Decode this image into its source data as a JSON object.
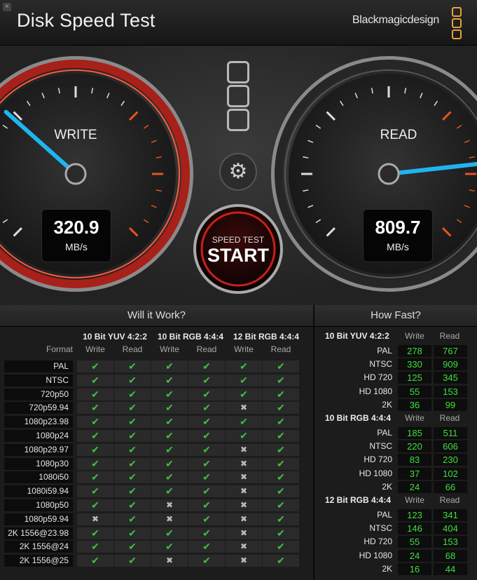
{
  "window": {
    "close_glyph": "×",
    "title": "Disk Speed Test",
    "brand": "Blackmagicdesign"
  },
  "colors": {
    "accent": "#e8a23a",
    "needle": "#1fb4f0",
    "check": "#3fc13f",
    "value": "#3ce03c",
    "red": "#c8201a"
  },
  "gauges": {
    "write": {
      "label": "WRITE",
      "value": "320.9",
      "unit": "MB/s",
      "value_num": 320.9
    },
    "read": {
      "label": "READ",
      "value": "809.7",
      "unit": "MB/s",
      "value_num": 809.7
    }
  },
  "start": {
    "top_label": "SPEED TEST",
    "main_label": "START"
  },
  "will_it_work": {
    "title": "Will it Work?",
    "format_label": "Format",
    "groups": [
      "10 Bit YUV 4:2:2",
      "10 Bit RGB 4:4:4",
      "12 Bit RGB 4:4:4"
    ],
    "sub": [
      "Write",
      "Read"
    ],
    "rows": [
      {
        "fmt": "PAL",
        "cells": [
          1,
          1,
          1,
          1,
          1,
          1
        ]
      },
      {
        "fmt": "NTSC",
        "cells": [
          1,
          1,
          1,
          1,
          1,
          1
        ]
      },
      {
        "fmt": "720p50",
        "cells": [
          1,
          1,
          1,
          1,
          1,
          1
        ]
      },
      {
        "fmt": "720p59.94",
        "cells": [
          1,
          1,
          1,
          1,
          0,
          1
        ]
      },
      {
        "fmt": "1080p23.98",
        "cells": [
          1,
          1,
          1,
          1,
          1,
          1
        ]
      },
      {
        "fmt": "1080p24",
        "cells": [
          1,
          1,
          1,
          1,
          1,
          1
        ]
      },
      {
        "fmt": "1080p29.97",
        "cells": [
          1,
          1,
          1,
          1,
          0,
          1
        ]
      },
      {
        "fmt": "1080p30",
        "cells": [
          1,
          1,
          1,
          1,
          0,
          1
        ]
      },
      {
        "fmt": "1080i50",
        "cells": [
          1,
          1,
          1,
          1,
          0,
          1
        ]
      },
      {
        "fmt": "1080i59.94",
        "cells": [
          1,
          1,
          1,
          1,
          0,
          1
        ]
      },
      {
        "fmt": "1080p50",
        "cells": [
          1,
          1,
          0,
          1,
          0,
          1
        ]
      },
      {
        "fmt": "1080p59.94",
        "cells": [
          0,
          1,
          0,
          1,
          0,
          1
        ]
      },
      {
        "fmt": "2K 1556@23.98",
        "cells": [
          1,
          1,
          1,
          1,
          0,
          1
        ]
      },
      {
        "fmt": "2K 1556@24",
        "cells": [
          1,
          1,
          1,
          1,
          0,
          1
        ]
      },
      {
        "fmt": "2K 1556@25",
        "cells": [
          1,
          1,
          0,
          1,
          0,
          1
        ]
      }
    ]
  },
  "how_fast": {
    "title": "How Fast?",
    "groups": [
      {
        "name": "10 Bit YUV 4:2:2",
        "write_label": "Write",
        "read_label": "Read",
        "rows": [
          {
            "fmt": "PAL",
            "write": "278",
            "read": "767"
          },
          {
            "fmt": "NTSC",
            "write": "330",
            "read": "909"
          },
          {
            "fmt": "HD 720",
            "write": "125",
            "read": "345"
          },
          {
            "fmt": "HD 1080",
            "write": "55",
            "read": "153"
          },
          {
            "fmt": "2K",
            "write": "36",
            "read": "99"
          }
        ]
      },
      {
        "name": "10 Bit RGB 4:4:4",
        "write_label": "Write",
        "read_label": "Read",
        "rows": [
          {
            "fmt": "PAL",
            "write": "185",
            "read": "511"
          },
          {
            "fmt": "NTSC",
            "write": "220",
            "read": "606"
          },
          {
            "fmt": "HD 720",
            "write": "83",
            "read": "230"
          },
          {
            "fmt": "HD 1080",
            "write": "37",
            "read": "102"
          },
          {
            "fmt": "2K",
            "write": "24",
            "read": "66"
          }
        ]
      },
      {
        "name": "12 Bit RGB 4:4:4",
        "write_label": "Write",
        "read_label": "Read",
        "rows": [
          {
            "fmt": "PAL",
            "write": "123",
            "read": "341"
          },
          {
            "fmt": "NTSC",
            "write": "146",
            "read": "404"
          },
          {
            "fmt": "HD 720",
            "write": "55",
            "read": "153"
          },
          {
            "fmt": "HD 1080",
            "write": "24",
            "read": "68"
          },
          {
            "fmt": "2K",
            "write": "16",
            "read": "44"
          }
        ]
      }
    ]
  },
  "icons": {
    "settings": "gear-icon",
    "check": "✔",
    "cross": "✖",
    "gear_glyph": "⚙"
  }
}
